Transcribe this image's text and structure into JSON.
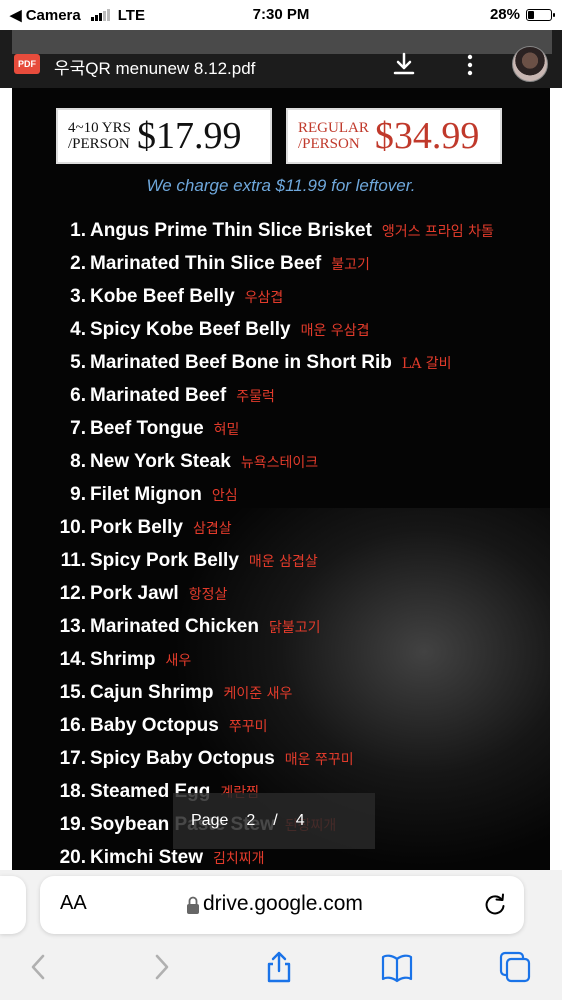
{
  "status_bar": {
    "back_app": "◀ Camera",
    "carrier": "LTE",
    "time": "7:30 PM",
    "battery": "28%",
    "battery_level": 0.28
  },
  "viewer": {
    "pdf_badge": "PDF",
    "file_name": "우국QR menunew 8.12.pdf"
  },
  "menu": {
    "kids_price_label_1": "4~10 YRS",
    "kids_price_label_2": "/PERSON",
    "kids_price": "$17.99",
    "regular_label_1": "REGULAR",
    "regular_label_2": "/PERSON",
    "regular_price": "$34.99",
    "leftover_note": "We charge extra $11.99 for leftover.",
    "items": [
      {
        "num": "1.",
        "name": "Angus Prime Thin Slice Brisket",
        "kr": "앵거스 프라임 차돌"
      },
      {
        "num": "2.",
        "name": "Marinated Thin Slice Beef",
        "kr": "불고기"
      },
      {
        "num": "3.",
        "name": "Kobe Beef Belly",
        "kr": "우삼겹"
      },
      {
        "num": "4.",
        "name": "Spicy Kobe Beef Belly",
        "kr": "매운 우삼겹"
      },
      {
        "num": "5.",
        "name": "Marinated Beef Bone in Short Rib",
        "kr": "LA 갈비"
      },
      {
        "num": "6.",
        "name": "Marinated Beef",
        "kr": "주물럭"
      },
      {
        "num": "7.",
        "name": "Beef Tongue",
        "kr": "혀밑"
      },
      {
        "num": "8.",
        "name": "New York Steak",
        "kr": "뉴욕스테이크"
      },
      {
        "num": "9.",
        "name": "Filet Mignon",
        "kr": "안심"
      },
      {
        "num": "10.",
        "name": "Pork Belly",
        "kr": "삼겹살"
      },
      {
        "num": "11.",
        "name": "Spicy Pork Belly",
        "kr": "매운 삼겹살"
      },
      {
        "num": "12.",
        "name": "Pork Jawl",
        "kr": "항정살"
      },
      {
        "num": "13.",
        "name": "Marinated Chicken",
        "kr": "닭불고기"
      },
      {
        "num": "14.",
        "name": "Shrimp",
        "kr": "새우"
      },
      {
        "num": "15.",
        "name": "Cajun Shrimp",
        "kr": "케이준 새우"
      },
      {
        "num": "16.",
        "name": "Baby Octopus",
        "kr": "쭈꾸미"
      },
      {
        "num": "17.",
        "name": "Spicy Baby Octopus",
        "kr": "매운 쭈꾸미"
      },
      {
        "num": "18.",
        "name": "Steamed Egg",
        "kr": "계란찜"
      },
      {
        "num": "19.",
        "name": "Soybean Paste Stew",
        "kr": "된장찌개"
      },
      {
        "num": "20.",
        "name": "Kimchi Stew",
        "kr": "김치찌개"
      }
    ]
  },
  "page_indicator": {
    "label": "Page",
    "current": "2",
    "separator": "/",
    "total": "4"
  },
  "safari": {
    "aa_label": "AA",
    "url": "drive.google.com"
  },
  "colors": {
    "kr_text": "#e23b2b",
    "note_blue": "#6fa8dc",
    "regular_red": "#c0392b"
  }
}
